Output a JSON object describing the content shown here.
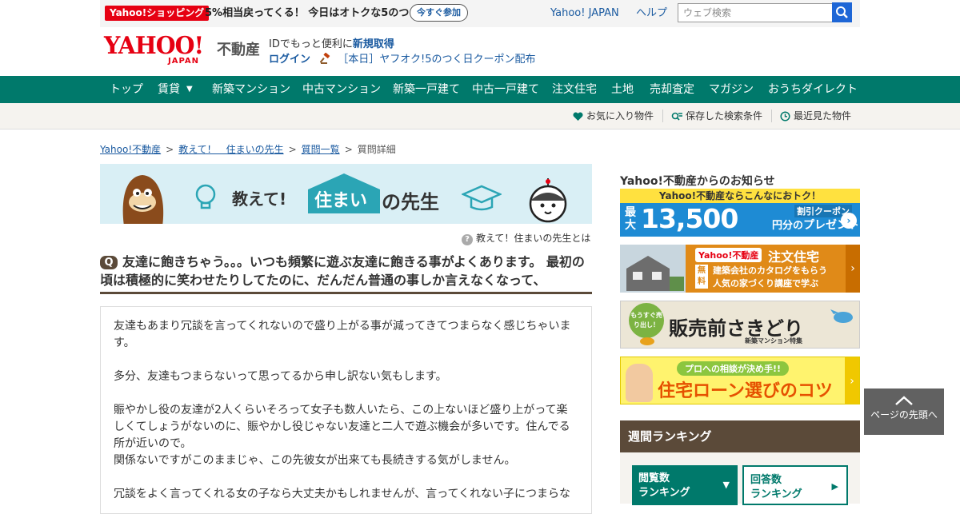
{
  "topbar": {
    "shop_badge": "Yahoo!ショッピング",
    "promo_text": "5%相当戻ってくる！ 今日はオトクな5のつく日",
    "join_label": "今すぐ参加",
    "links": [
      "Yahoo! JAPAN",
      "ヘルプ"
    ],
    "search_placeholder": "ウェブ検索"
  },
  "header": {
    "logo_text": "YAHOO!",
    "logo_sub": "JAPAN",
    "service_name": "不動産",
    "id_prefix": "IDでもっと便利に",
    "id_link": "新規取得",
    "login": "ログイン",
    "auction_notice": "［本日］ヤフオク!5のつく日クーポン配布"
  },
  "nav": {
    "items": [
      "トップ",
      "賃貸",
      "新築マンション",
      "中古マンション",
      "新築一戸建て",
      "中古一戸建て",
      "注文住宅",
      "土地",
      "売却査定",
      "マガジン",
      "おうちダイレクト"
    ],
    "dropdown_glyph": "▼"
  },
  "subnav": {
    "favorites": "お気に入り物件",
    "saved_search": "保存した検索条件",
    "recent": "最近見た物件"
  },
  "breadcrumb": {
    "items": [
      "Yahoo!不動産",
      "教えて！　住まいの先生",
      "質問一覧"
    ],
    "current": "質問詳細",
    "separator": ">"
  },
  "banner": {
    "part1": "教えて!",
    "part2": "住まい",
    "part3": "の先生"
  },
  "about_link": "教えて！住まいの先生とは",
  "question": {
    "badge": "Q",
    "title": "友達に飽きちゃう。。。いつも頻繁に遊ぶ友達に飽きる事がよくあります。 最初の頃は積極的に笑わせたりしてたのに、だんだん普通の事しか言えなくなって、",
    "body": [
      "友達もあまり冗談を言ってくれないので盛り上がる事が減ってきてつまらなく感じちゃいます。",
      "多分、友達もつまらないって思ってるから申し訳ない気もします。",
      "賑やかし役の友達が2人くらいそろって女子も数人いたら、この上ないほど盛り上がって楽しくてしょうがないのに、賑やかし役じゃない友達と二人で遊ぶ機会が多いです。住んでる所が近いので。\n関係ないですがこのままじゃ、この先彼女が出来ても長続きする気がしません。",
      "冗談をよく言ってくれる女の子なら大丈夫かもしれませんが、言ってくれない子につまらな"
    ]
  },
  "sidebar": {
    "notice_heading": "Yahoo!不動産からのお知らせ",
    "ad1": {
      "top": "Yahoo!不動産ならこんなにおトク！",
      "max": "最大",
      "amount": "13,500",
      "yen_line1": "円分の",
      "yen_line2": "プレゼント",
      "coupon": "割引クーポン"
    },
    "ad2": {
      "brand": "Yahoo!不動産",
      "title": "注文住宅",
      "free": "無料",
      "line1": "建築会社のカタログをもらう",
      "line2": "人気の家づくり講座で学ぶ"
    },
    "ad3": {
      "tag": "もうすぐ売り出し！",
      "title": "販売前さきどり",
      "sub": "新築マンション特集"
    },
    "ad4": {
      "pill": "プロへの相談が決め手!!",
      "title": "住宅ローン選びのコツ"
    },
    "ranking_heading": "週間ランキング",
    "rank_tab1": "閲覧数\nランキング",
    "rank_tab2": "回答数\nランキング"
  },
  "totop": "ページの先頭へ",
  "colors": {
    "nav_green": "#00796b",
    "brand_red": "#e60012",
    "question_brown": "#5b4a39"
  }
}
